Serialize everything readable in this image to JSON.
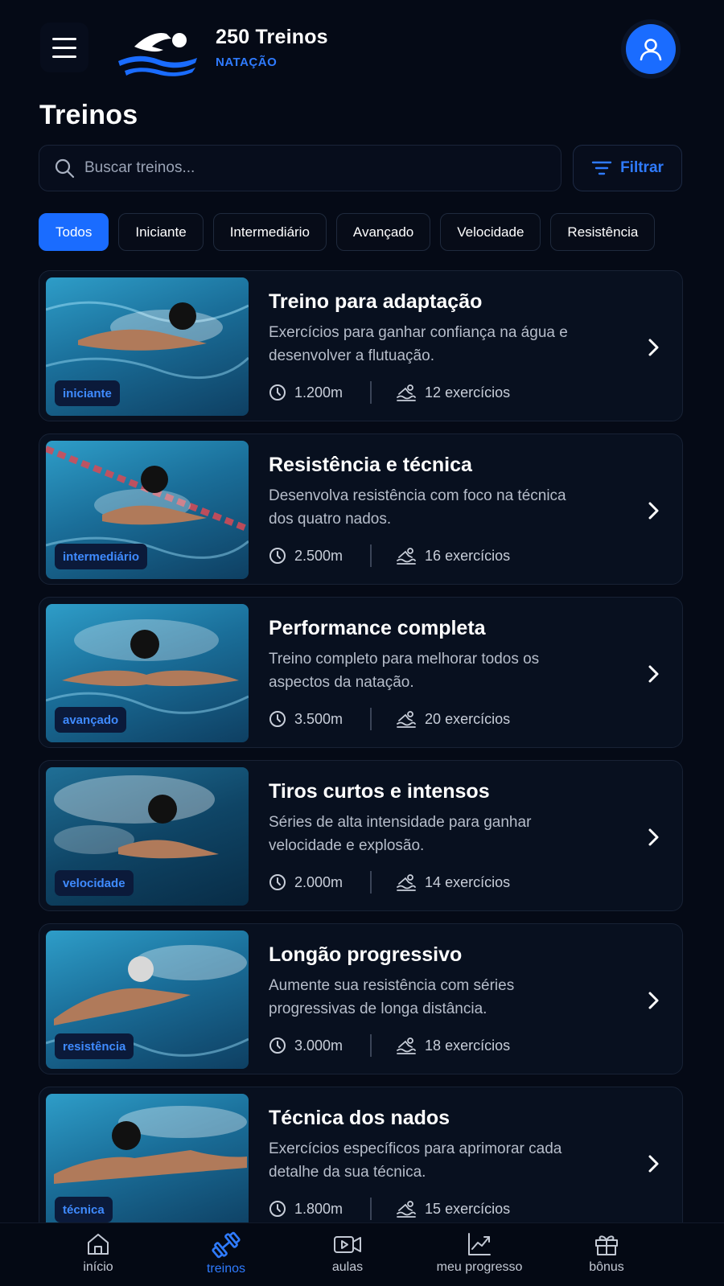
{
  "header": {
    "title": "250 Treinos",
    "subtitle": "NATAÇÃO",
    "menu_icon": "hamburger-icon",
    "profile_icon": "user-icon"
  },
  "page_title": "Treinos",
  "search": {
    "placeholder": "Buscar treinos...",
    "value": ""
  },
  "filter_button": {
    "label": "Filtrar",
    "icon": "filter-icon"
  },
  "chips": [
    {
      "label": "Todos",
      "active": true
    },
    {
      "label": "Iniciante",
      "active": false
    },
    {
      "label": "Intermediário",
      "active": false
    },
    {
      "label": "Avançado",
      "active": false
    },
    {
      "label": "Velocidade",
      "active": false
    },
    {
      "label": "Resistência",
      "active": false
    }
  ],
  "workouts": [
    {
      "title": "Treino para adaptação",
      "description": "Exercícios para ganhar confiança na água e desenvolver a flutuação.",
      "level": "iniciante",
      "distance": "1.200m",
      "exercises": "12 exercícios"
    },
    {
      "title": "Resistência e técnica",
      "description": "Desenvolva resistência com foco na técnica dos quatro nados.",
      "level": "intermediário",
      "distance": "2.500m",
      "exercises": "16 exercícios"
    },
    {
      "title": "Performance completa",
      "description": "Treino completo para melhorar todos os aspectos da natação.",
      "level": "avançado",
      "distance": "3.500m",
      "exercises": "20 exercícios"
    },
    {
      "title": "Tiros curtos e intensos",
      "description": "Séries de alta intensidade para ganhar velocidade e explosão.",
      "level": "velocidade",
      "distance": "2.000m",
      "exercises": "14 exercícios"
    },
    {
      "title": "Longão progressivo",
      "description": "Aumente sua resistência com séries progressivas de longa distância.",
      "level": "resistência",
      "distance": "3.000m",
      "exercises": "18 exercícios"
    },
    {
      "title": "Técnica dos nados",
      "description": "Exercícios específicos para aprimorar cada detalhe da sua técnica.",
      "level": "técnica",
      "distance": "1.800m",
      "exercises": "15 exercícios"
    }
  ],
  "bottom_nav": [
    {
      "label": "início",
      "icon": "home-icon",
      "active": false
    },
    {
      "label": "treinos",
      "icon": "dumbbell-icon",
      "active": true
    },
    {
      "label": "aulas",
      "icon": "video-icon",
      "active": false
    },
    {
      "label": "meu progresso",
      "icon": "chart-icon",
      "active": false
    },
    {
      "label": "bônus",
      "icon": "gift-icon",
      "active": false
    }
  ],
  "colors": {
    "background": "#050a16",
    "accent": "#1a6cff",
    "accent_text": "#2f7bff",
    "card_bg": "#08101f"
  }
}
